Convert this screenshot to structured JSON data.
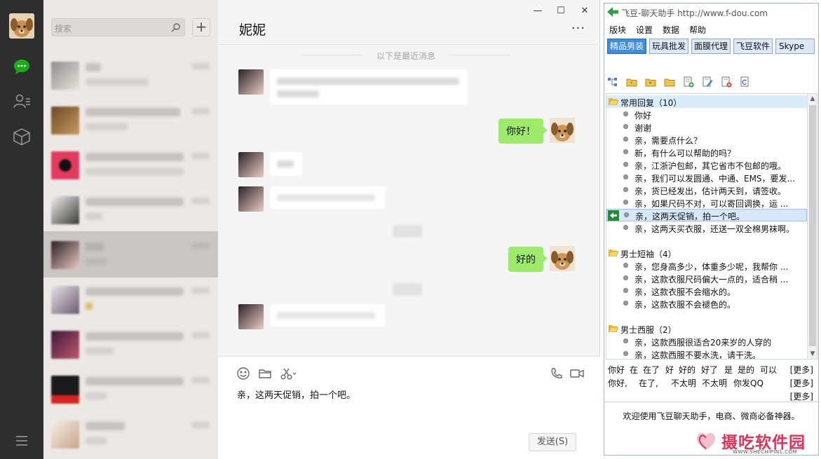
{
  "wechat": {
    "search_placeholder": "搜索",
    "add_label": "+",
    "chat_title": "妮妮",
    "more": "···",
    "time_divider": "以下是最近消息",
    "msg_me_1": "你好！",
    "msg_me_2": "好的",
    "input_text": "亲，这两天促销，拍一个吧。",
    "send_label": "发送(S)",
    "win_min": "—",
    "win_max": "☐",
    "win_close": "✕"
  },
  "feidou": {
    "title": "飞豆-聊天助手 http://www.f-dou.com",
    "menu": [
      "版块",
      "设置",
      "数据",
      "帮助"
    ],
    "tabs": [
      "精品男装",
      "玩具批发",
      "面膜代理",
      "飞豆软件",
      "Skype"
    ],
    "groups": [
      {
        "name": "常用回复（10）",
        "items": [
          "你好",
          "谢谢",
          "亲，需要点什么？",
          "新，有什么可以帮助的吗？",
          "亲，江浙沪包邮，其它省市不包邮的哦。",
          "亲，我们可以发圆通、中通、EMS，要发...",
          "亲，货已经发出，估计两天到，请签收。",
          "亲，如果尺码不对，可以寄回调换，运 ...",
          "亲，这两天促销，拍一个吧。",
          "亲，这两天买衣服，还送一双全棉男袜啊。"
        ]
      },
      {
        "name": "男士短袖（4）",
        "items": [
          "亲，您身高多少，体重多少呢，我帮你 ...",
          "亲，这款衣服尺码偏大一点的，适合稍 ...",
          "亲，这款衣服不会缩水的。",
          "亲，这款衣服不会褪色的。"
        ]
      },
      {
        "name": "男士西服（2）",
        "items": [
          "亲，这款西服很适合20来岁的人穿的",
          "亲，这款西服不要水洗，请干洗。"
        ]
      }
    ],
    "quick_row1": [
      "你好",
      "在",
      "在了",
      "好",
      "好的",
      "好了",
      "是",
      "是的",
      "可以"
    ],
    "quick_row2": [
      "你好,",
      "在了,",
      "不太明",
      "不太明",
      "你发QQ"
    ],
    "more_label": "[更多]",
    "footer": "欢迎使用飞豆聊天助手，电商、微商必备神器。"
  },
  "watermark": {
    "name": "摄吃软件园",
    "url": "WWW.SHECHIPIN1.COM"
  }
}
